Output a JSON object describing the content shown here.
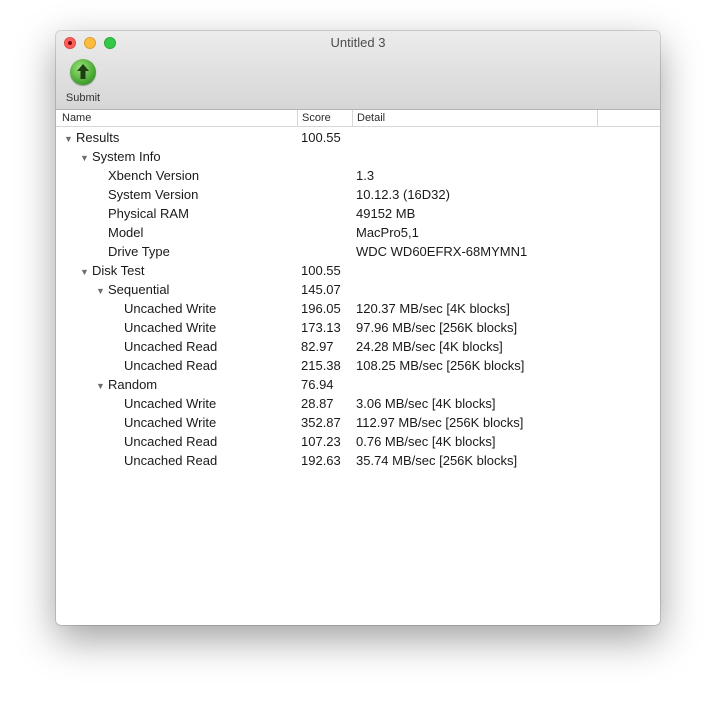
{
  "window": {
    "title": "Untitled 3"
  },
  "toolbar": {
    "submit_label": "Submit",
    "submit_icon": "upload-arrow-icon"
  },
  "columns": {
    "name": "Name",
    "score": "Score",
    "detail": "Detail"
  },
  "rows": [
    {
      "name": "Results",
      "score": "100.55",
      "detail": "",
      "level": 0,
      "expanded": true
    },
    {
      "name": "System Info",
      "score": "",
      "detail": "",
      "level": 1,
      "expanded": true
    },
    {
      "name": "Xbench Version",
      "score": "",
      "detail": "1.3",
      "level": 2
    },
    {
      "name": "System Version",
      "score": "",
      "detail": "10.12.3 (16D32)",
      "level": 2
    },
    {
      "name": "Physical RAM",
      "score": "",
      "detail": "49152 MB",
      "level": 2
    },
    {
      "name": "Model",
      "score": "",
      "detail": "MacPro5,1",
      "level": 2
    },
    {
      "name": "Drive Type",
      "score": "",
      "detail": "WDC WD60EFRX-68MYMN1",
      "level": 2
    },
    {
      "name": "Disk Test",
      "score": "100.55",
      "detail": "",
      "level": 1,
      "expanded": true
    },
    {
      "name": "Sequential",
      "score": "145.07",
      "detail": "",
      "level": 2,
      "expanded": true
    },
    {
      "name": "Uncached Write",
      "score": "196.05",
      "detail": "120.37 MB/sec [4K blocks]",
      "level": 3
    },
    {
      "name": "Uncached Write",
      "score": "173.13",
      "detail": "97.96 MB/sec [256K blocks]",
      "level": 3
    },
    {
      "name": "Uncached Read",
      "score": "82.97",
      "detail": "24.28 MB/sec [4K blocks]",
      "level": 3
    },
    {
      "name": "Uncached Read",
      "score": "215.38",
      "detail": "108.25 MB/sec [256K blocks]",
      "level": 3
    },
    {
      "name": "Random",
      "score": "76.94",
      "detail": "",
      "level": 2,
      "expanded": true
    },
    {
      "name": "Uncached Write",
      "score": "28.87",
      "detail": "3.06 MB/sec [4K blocks]",
      "level": 3
    },
    {
      "name": "Uncached Write",
      "score": "352.87",
      "detail": "112.97 MB/sec [256K blocks]",
      "level": 3
    },
    {
      "name": "Uncached Read",
      "score": "107.23",
      "detail": "0.76 MB/sec [4K blocks]",
      "level": 3
    },
    {
      "name": "Uncached Read",
      "score": "192.63",
      "detail": "35.74 MB/sec [256K blocks]",
      "level": 3
    }
  ]
}
